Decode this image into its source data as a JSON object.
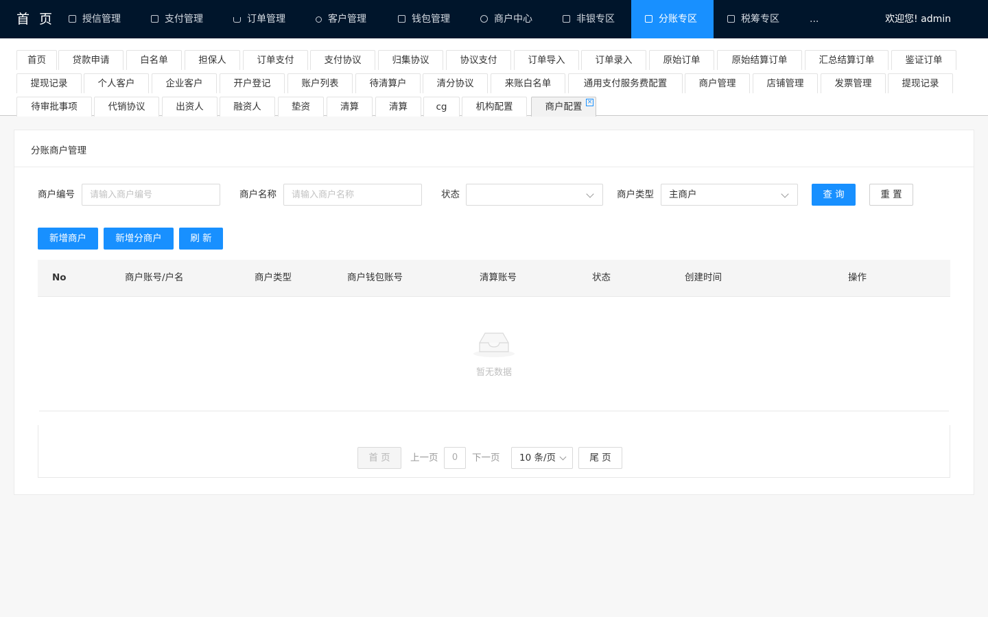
{
  "header": {
    "brand": "首 页",
    "nav": [
      {
        "label": "授信管理",
        "icon": "credit-doc-icon"
      },
      {
        "label": "支付管理",
        "icon": "payment-doc-icon"
      },
      {
        "label": "订单管理",
        "icon": "cart-icon"
      },
      {
        "label": "客户管理",
        "icon": "user-icon"
      },
      {
        "label": "钱包管理",
        "icon": "wallet-doc-icon"
      },
      {
        "label": "商户中心",
        "icon": "clock-icon"
      },
      {
        "label": "非银专区",
        "icon": "nonbank-doc-icon"
      },
      {
        "label": "分账专区",
        "icon": "split-doc-icon",
        "active": true
      },
      {
        "label": "税筹专区",
        "icon": "tax-doc-icon"
      },
      {
        "label": "...",
        "icon": ""
      }
    ],
    "welcome": "欢迎您!  admin"
  },
  "tabs": {
    "row1": [
      "首页",
      "贷款申请",
      "白名单",
      "担保人",
      "订单支付",
      "支付协议",
      "归集协议",
      "协议支付",
      "订单导入",
      "订单录入",
      "原始订单",
      "原始结算订单",
      "汇总结算订单",
      "鉴证订单"
    ],
    "row2": [
      "提现记录",
      "个人客户",
      "企业客户",
      "开户登记",
      "账户列表",
      "待清算户",
      "清分协议",
      "来账白名单",
      "通用支付服务费配置",
      "商户管理",
      "店铺管理",
      "发票管理",
      "提现记录"
    ],
    "row3": [
      "待审批事项",
      "代销协议",
      "出资人",
      "融资人",
      "垫资",
      "清算",
      "清算",
      "cg",
      "机构配置",
      "商户配置"
    ],
    "active_tab": "商户配置",
    "close_glyph": "×"
  },
  "card": {
    "title": "分账商户管理",
    "filters": {
      "merchant_no_label": "商户编号",
      "merchant_no_placeholder": "请输入商户编号",
      "merchant_no_value": "",
      "merchant_name_label": "商户名称",
      "merchant_name_placeholder": "请输入商户名称",
      "merchant_name_value": "",
      "status_label": "状态",
      "status_value": "",
      "type_label": "商户类型",
      "type_value": "主商户",
      "query_button": "查 询",
      "reset_button": "重 置"
    },
    "actions": {
      "add_merchant": "新增商户",
      "add_sub_merchant": "新增分商户",
      "refresh": "刷 新"
    },
    "table": {
      "columns": [
        "No",
        "商户账号/户名",
        "商户类型",
        "商户钱包账号",
        "清算账号",
        "状态",
        "创建时间",
        "操作"
      ],
      "rows": [],
      "empty_text": "暂无数据"
    },
    "pagination": {
      "first": "首 页",
      "prev": "上一页",
      "page": "0",
      "next": "下一页",
      "page_size": "10 条/页",
      "last": "尾 页"
    }
  },
  "colors": {
    "topbar": "#00152b",
    "accent": "#1890ff"
  }
}
